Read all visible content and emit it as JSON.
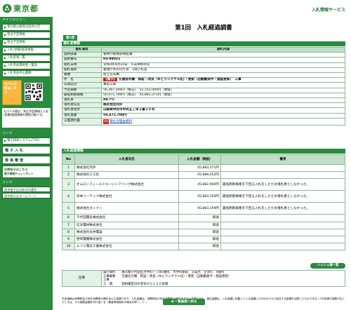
{
  "header": {
    "logo_text": "東京都",
    "service_name": "入札情報サービス"
  },
  "sidebar": {
    "menu_heading": "メインメニュー",
    "items": [
      {
        "label": "東京都公報発注案件公告"
      },
      {
        "label": "発注予定情報"
      },
      {
        "label": "発注予定情報"
      },
      {
        "label": "入札(見積)経過情報"
      },
      {
        "label": "入札結果一覧"
      },
      {
        "label": "入札参加資格者一覧表"
      },
      {
        "label": "入札参加申込書類"
      }
    ],
    "mobile_label": "モバイル版はこちら",
    "mobile_note": "モバイル版は、発注予定情報と入札(見積)経過情報を閲覧可能です。",
    "other_heading": "リンク",
    "big_links": [
      {
        "label": "電子調達システム(TOP)"
      },
      {
        "label": "電 子 入 札"
      },
      {
        "label": "資 格 審 査"
      }
    ],
    "help_label": "お問合せはこちら",
    "help_sub": "電子調達チャットボット",
    "links_heading": "リンク",
    "foot_links": [
      {
        "label": "東京電子自治体共同運営"
      },
      {
        "label": "東京都公式ホームページ"
      }
    ]
  },
  "main": {
    "title": "第1回　入札経過調書",
    "round_badge": "第1回",
    "info_heading": "落札者情報",
    "col_item": "落札項目",
    "col_content": "落札内容",
    "rows": [
      {
        "label": "契約部署",
        "value": "警視庁総務部用度課"
      },
      {
        "label": "契約番号",
        "value": "03-99021"
      },
      {
        "label": "開札日時",
        "value": "令和4年4月14日　午前9時00分"
      },
      {
        "label": "開札場所",
        "value": "警視庁丸の内庁舎　1階入札室"
      },
      {
        "label": "業種",
        "value": "陸上信号機"
      },
      {
        "label": "件　名",
        "value_badge": "【電子】",
        "value": "交通信号機　移設・改良（ゆとりシグナル化）・更新（自動動発今・施設更新）　工事"
      },
      {
        "label": "公表区分",
        "value": "事前公表"
      },
      {
        "label": "予定価格",
        "value": "56,267,200円（税込）　51,152,000円（税抜）"
      },
      {
        "label": "最低制限価格",
        "value": "50,471,700円（税込）　45,883,371円（税抜）"
      },
      {
        "label": "落札率",
        "value": "89.7%"
      },
      {
        "label": "落札者氏名",
        "value": "株式会社内外"
      },
      {
        "label": "落札者住所",
        "value": "山梨県中府市中央五丁目２番２６号"
      },
      {
        "label": "落札金額",
        "value": "50,471,700円"
      },
      {
        "label": "公開添付書",
        "value": "落札の理由資料"
      }
    ],
    "bid_heading": "入札経過情報",
    "bid_cols": {
      "no": "No",
      "name": "入札者氏名",
      "amount": "入札金額（税抜）",
      "note": "備考"
    },
    "bids": [
      {
        "no": "1",
        "name": "株式会社内外",
        "amount": "45,883,371円",
        "note": ""
      },
      {
        "no": "2",
        "name": "株式会社三工社",
        "amount": "45,888,452円",
        "note": ""
      },
      {
        "no": "3",
        "name": "オムロンフィールドエンジニアリング株式会社",
        "amount": "45,882,900円",
        "note": "最低制限価格を下回る入札をしたため落札者としなかった。"
      },
      {
        "no": "4",
        "name": "日本リーテック株式会社",
        "amount": "45,883,350円",
        "note": "最低制限価格を下回る入札をしたため落札者としなかった。"
      },
      {
        "no": "5",
        "name": "株式会社カンドー",
        "amount": "45,883,359円",
        "note": "最低制限価格を下回る入札をしたため落札者としなかった。"
      },
      {
        "no": "6",
        "name": "千代田電気株式会社",
        "amount": "辞退",
        "note": ""
      },
      {
        "no": "7",
        "name": "信号電材株式会社",
        "amount": "辞退",
        "note": ""
      },
      {
        "no": "8",
        "name": "株式会社丸井電設",
        "amount": "辞退",
        "note": ""
      },
      {
        "no": "9",
        "name": "岩崎電機株式会社",
        "amount": "辞退",
        "note": ""
      },
      {
        "no": "10",
        "name": "ムツミ電気工業株式会社",
        "amount": "辞退",
        "note": ""
      }
    ],
    "history_button": "ハッシュ値一覧",
    "remark_label": "記事",
    "remark_lines": [
      "履行場所　　東京都千代田区大手町一丁目5番先　大手町駅前　交差点　を含む　4箇所",
      "工事概要　　交通信号機　移設・改良（ゆとりシグナル化）・更新（自動動発今・施設更新）",
      "工事",
      "工　期　　　契約確定日の翌日から１２０日間"
    ],
    "footnote": "予定価格は消費税及び地方消費税の額を含んだ金額であり、入札金額は、消費税及び地方消費税の額を含まない金額である。落札金額は、入札金額に記載している金額に100分の110に相当する金額を加算したものである（1円未満の端数が生じたときは、その端数金額を切り捨てる（業者単価契約の場合を除く。））。",
    "back_button": "一覧画面へ戻る"
  }
}
